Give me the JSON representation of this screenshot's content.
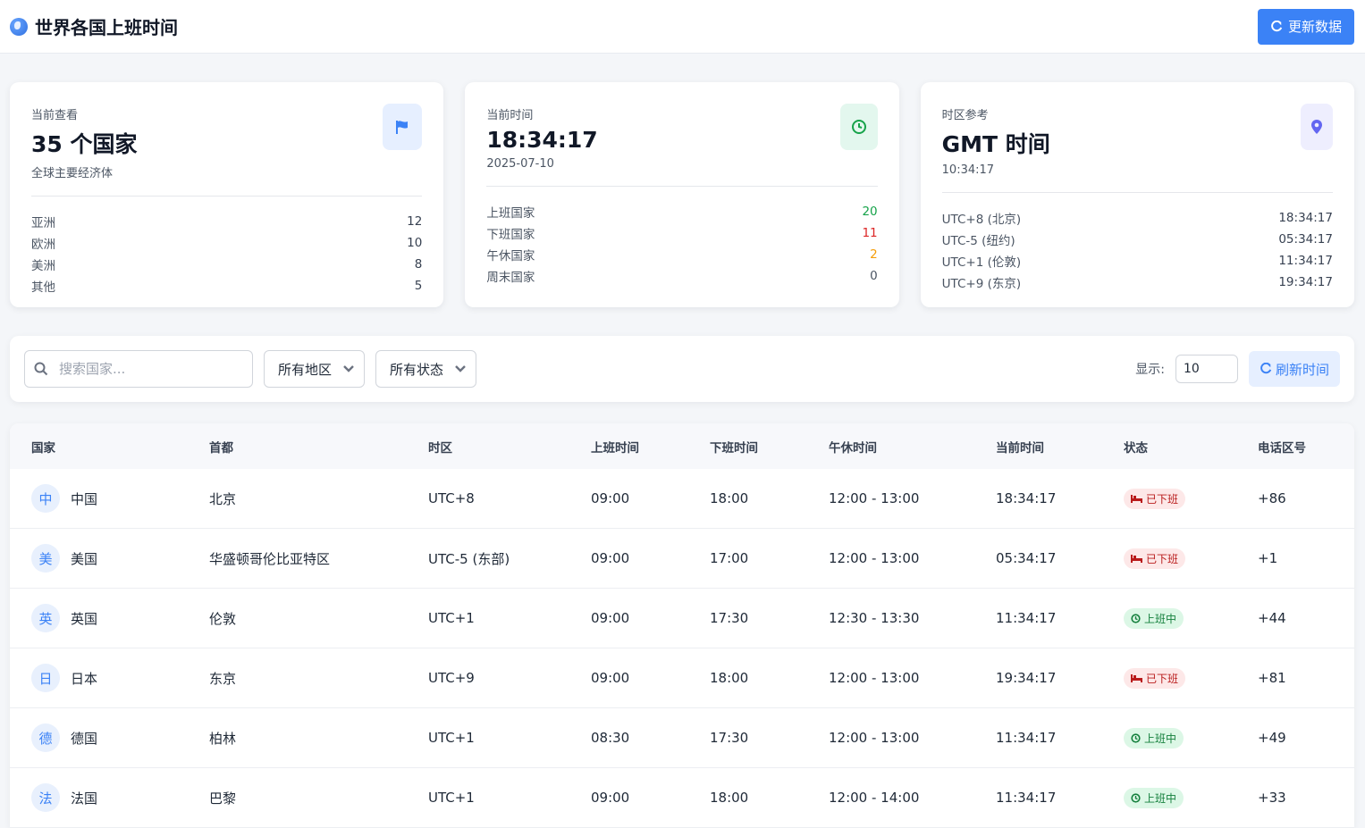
{
  "header": {
    "title": "世界各国上班时间",
    "refresh_label": "更新数据"
  },
  "cards": [
    {
      "label": "当前查看",
      "value": "35 个国家",
      "sub": "全球主要经济体",
      "icon": "flag-icon",
      "icon_bg": "#e6efff",
      "icon_color": "#3b82f6",
      "rows": [
        {
          "label": "亚洲",
          "value": "12"
        },
        {
          "label": "欧洲",
          "value": "10"
        },
        {
          "label": "美洲",
          "value": "8"
        },
        {
          "label": "其他",
          "value": "5"
        }
      ]
    },
    {
      "label": "当前时间",
      "value": "18:34:17",
      "sub": "2025-07-10",
      "icon": "clock-icon",
      "icon_bg": "#e3f7ee",
      "icon_color": "#16a34a",
      "rows": [
        {
          "label": "上班国家",
          "value": "20",
          "color": "#16a34a"
        },
        {
          "label": "下班国家",
          "value": "11",
          "color": "#dc2626"
        },
        {
          "label": "午休国家",
          "value": "2",
          "color": "#f59e0b"
        },
        {
          "label": "周末国家",
          "value": "0",
          "color": "#4b5563"
        }
      ]
    },
    {
      "label": "时区参考",
      "value": "GMT 时间",
      "sub": "10:34:17",
      "icon": "map-pin-icon",
      "icon_bg": "#eeeefe",
      "icon_color": "#6366f1",
      "rows": [
        {
          "label": "UTC+8 (北京)",
          "value": "18:34:17"
        },
        {
          "label": "UTC-5 (纽约)",
          "value": "05:34:17"
        },
        {
          "label": "UTC+1 (伦敦)",
          "value": "11:34:17"
        },
        {
          "label": "UTC+9 (东京)",
          "value": "19:34:17"
        }
      ]
    }
  ],
  "filters": {
    "search_placeholder": "搜索国家...",
    "region": "所有地区",
    "status": "所有状态",
    "show_label": "显示:",
    "show_value": "10",
    "refresh_label": "刷新时间"
  },
  "table": {
    "columns": [
      "国家",
      "首都",
      "时区",
      "上班时间",
      "下班时间",
      "午休时间",
      "当前时间",
      "状态",
      "电话区号"
    ],
    "rows": [
      {
        "initial": "中",
        "country": "中国",
        "capital": "北京",
        "tz": "UTC+8",
        "start": "09:00",
        "end": "18:00",
        "lunch": "12:00 - 13:00",
        "now": "18:34:17",
        "status": "已下班",
        "status_type": "off",
        "code": "+86"
      },
      {
        "initial": "美",
        "country": "美国",
        "capital": "华盛顿哥伦比亚特区",
        "tz": "UTC-5 (东部)",
        "start": "09:00",
        "end": "17:00",
        "lunch": "12:00 - 13:00",
        "now": "05:34:17",
        "status": "已下班",
        "status_type": "off",
        "code": "+1"
      },
      {
        "initial": "英",
        "country": "英国",
        "capital": "伦敦",
        "tz": "UTC+1",
        "start": "09:00",
        "end": "17:30",
        "lunch": "12:30 - 13:30",
        "now": "11:34:17",
        "status": "上班中",
        "status_type": "on",
        "code": "+44"
      },
      {
        "initial": "日",
        "country": "日本",
        "capital": "东京",
        "tz": "UTC+9",
        "start": "09:00",
        "end": "18:00",
        "lunch": "12:00 - 13:00",
        "now": "19:34:17",
        "status": "已下班",
        "status_type": "off",
        "code": "+81"
      },
      {
        "initial": "德",
        "country": "德国",
        "capital": "柏林",
        "tz": "UTC+1",
        "start": "08:30",
        "end": "17:30",
        "lunch": "12:00 - 13:00",
        "now": "11:34:17",
        "status": "上班中",
        "status_type": "on",
        "code": "+49"
      },
      {
        "initial": "法",
        "country": "法国",
        "capital": "巴黎",
        "tz": "UTC+1",
        "start": "09:00",
        "end": "18:00",
        "lunch": "12:00 - 14:00",
        "now": "11:34:17",
        "status": "上班中",
        "status_type": "on",
        "code": "+33"
      }
    ]
  }
}
